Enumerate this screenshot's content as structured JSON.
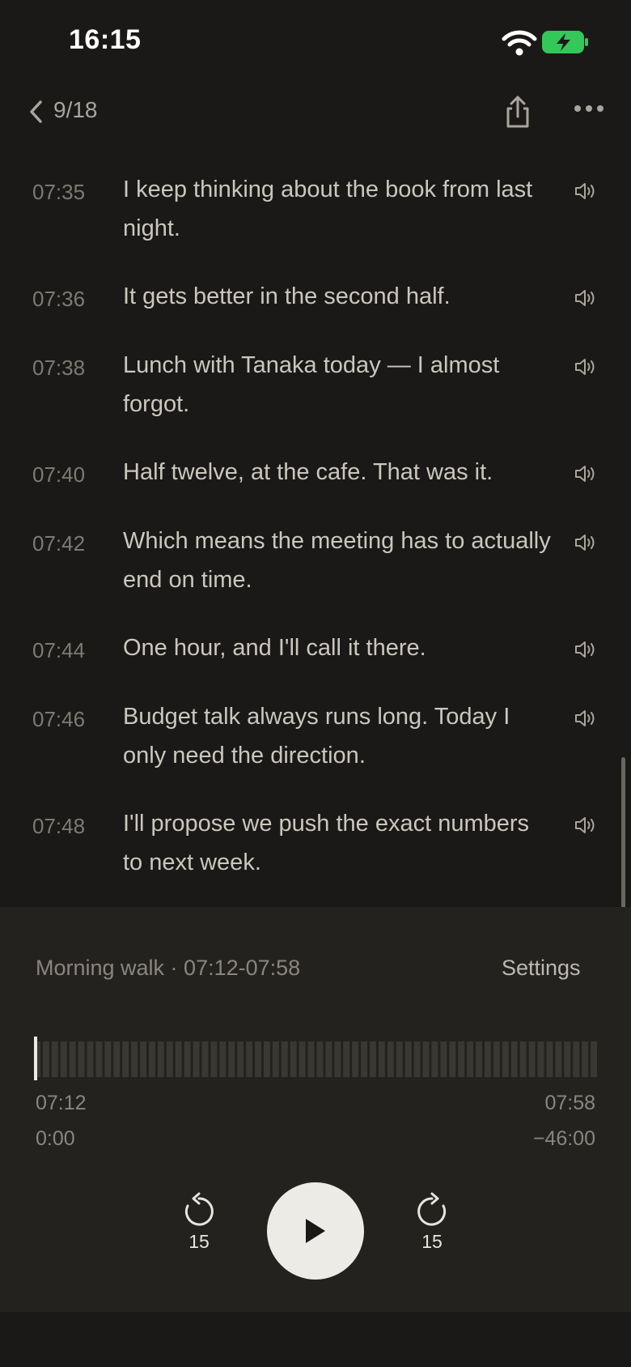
{
  "status": {
    "time": "16:15"
  },
  "nav": {
    "counter": "9/18"
  },
  "transcript": [
    {
      "time": "07:35",
      "text": "I keep thinking about the book from last night."
    },
    {
      "time": "07:36",
      "text": "It gets better in the second half."
    },
    {
      "time": "07:38",
      "text": "Lunch with Tanaka today — I almost forgot."
    },
    {
      "time": "07:40",
      "text": "Half twelve, at the cafe. That was it."
    },
    {
      "time": "07:42",
      "text": "Which means the meeting has to actually end on time."
    },
    {
      "time": "07:44",
      "text": "One hour, and I'll call it there."
    },
    {
      "time": "07:46",
      "text": "Budget talk always runs long. Today I only need the direction."
    },
    {
      "time": "07:48",
      "text": "I'll propose we push the exact numbers to next week."
    }
  ],
  "player": {
    "meta": "Morning walk · 07:12-07:58",
    "settings_label": "Settings",
    "range_start": "07:12",
    "range_end": "07:58",
    "position": "0:00",
    "remaining": "−46:00",
    "skip_back_label": "15",
    "skip_forward_label": "15",
    "progress": 0
  },
  "icons": {
    "wifi": "wifi-icon",
    "battery": "battery-charging-icon",
    "back": "chevron-left-icon",
    "share": "share-icon",
    "more": "more-horizontal-icon",
    "speaker": "speaker-icon",
    "skip_back": "rewind-15-icon",
    "play": "play-icon",
    "skip_forward": "forward-15-icon"
  },
  "colors": {
    "background": "#1a1917",
    "panel": "#23221f",
    "battery": "#34c759",
    "play_button": "#ecebe5"
  }
}
